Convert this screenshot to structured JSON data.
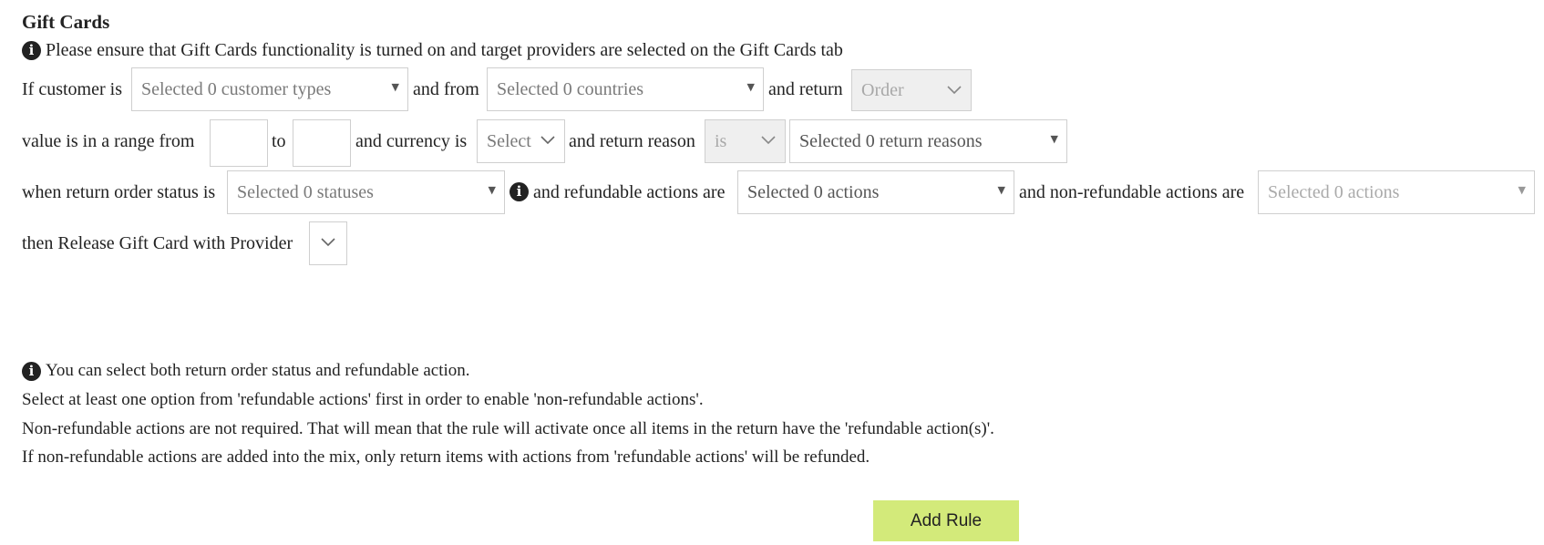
{
  "title": "Gift Cards",
  "info_notice": "Please ensure that Gift Cards functionality is turned on and target providers are selected on the Gift Cards tab",
  "row1": {
    "label_if_customer": "If customer is",
    "customer_types": "Selected 0 customer types",
    "label_and_from": "and from",
    "countries": "Selected 0 countries",
    "label_and_return": "and return",
    "return_type": "Order"
  },
  "row2": {
    "label_value_range": "value is in a range from",
    "range_from": "",
    "label_to": "to",
    "range_to": "",
    "label_currency": "and currency is",
    "currency": "Select",
    "label_return_reason": "and return reason",
    "reason_operator": "is",
    "return_reasons": "Selected 0 return reasons"
  },
  "row3": {
    "label_status": "when return order status is",
    "statuses": "Selected 0 statuses",
    "label_refundable": "and refundable actions are",
    "refundable_actions": "Selected 0 actions",
    "label_non_refundable": "and non-refundable actions are",
    "non_refundable_actions": "Selected 0 actions"
  },
  "row4": {
    "label_release": "then Release Gift Card with Provider",
    "provider": ""
  },
  "notes": [
    "You can select both return order status and refundable action.",
    "Select at least one option from 'refundable actions' first in order to enable 'non-refundable actions'.",
    "Non-refundable actions are not required. That will mean that the rule will activate once all items in the return have the 'refundable action(s)'.",
    "If non-refundable actions are added into the mix, only return items with actions from 'refundable actions' will be refunded."
  ],
  "add_rule_label": "Add Rule",
  "icons": {
    "info": "info-circle-icon",
    "dropdown": "triangle-down-icon",
    "chevron": "chevron-down-icon"
  },
  "colors": {
    "add_button_bg": "#d3ea7a",
    "disabled_bg": "#efefef"
  }
}
